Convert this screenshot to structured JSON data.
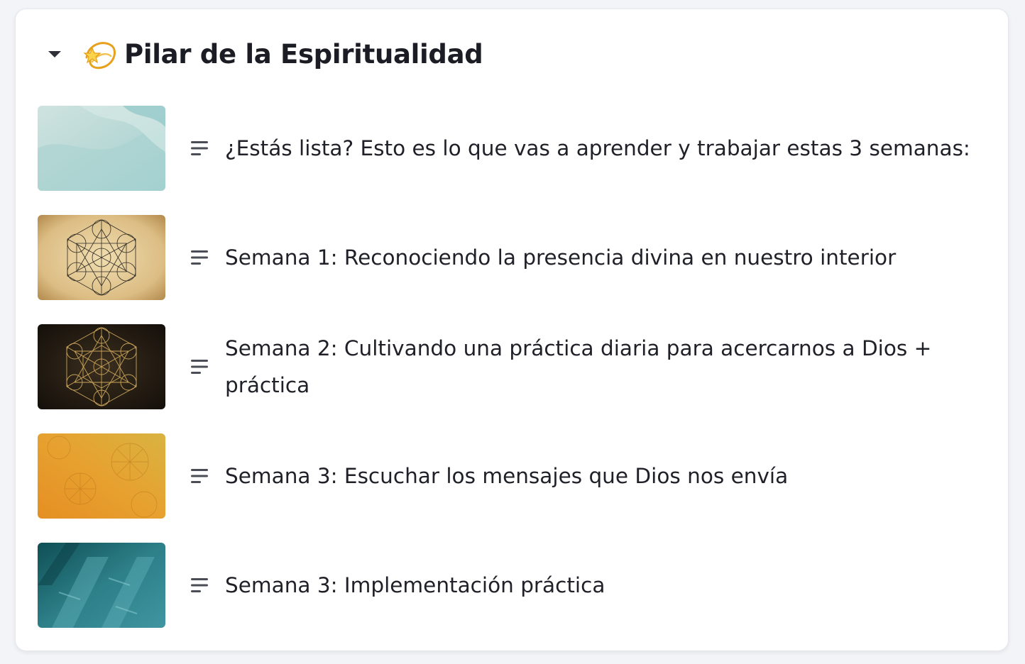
{
  "section": {
    "emoji": "💫",
    "title": "Pilar de la Espiritualidad",
    "expanded": true
  },
  "lessons": [
    {
      "title": "¿Estás lista? Esto es lo que vas a aprender y trabajar estas 3 semanas:",
      "thumbnail": "soft-teal-sand-waves"
    },
    {
      "title": "Semana 1: Reconociendo la presencia divina en nuestro interior",
      "thumbnail": "metatron-cube-on-parchment"
    },
    {
      "title": "Semana 2: Cultivando una práctica diaria para acercarnos a Dios + práctica",
      "thumbnail": "gold-metatron-cube-on-dark"
    },
    {
      "title": "Semana 3: Escuchar los mensajes que Dios nos envía",
      "thumbnail": "orange-ochre-texture"
    },
    {
      "title": "Semana 3: Implementación práctica",
      "thumbnail": "teal-blue-diagonal-blocks"
    }
  ],
  "icons": {
    "toggle": "caret-down-icon",
    "lesson_type": "text-lines-icon"
  },
  "colors": {
    "text": "#1f2028",
    "icon": "#4a4c56",
    "background": "#f3f4f8",
    "card": "#ffffff"
  }
}
